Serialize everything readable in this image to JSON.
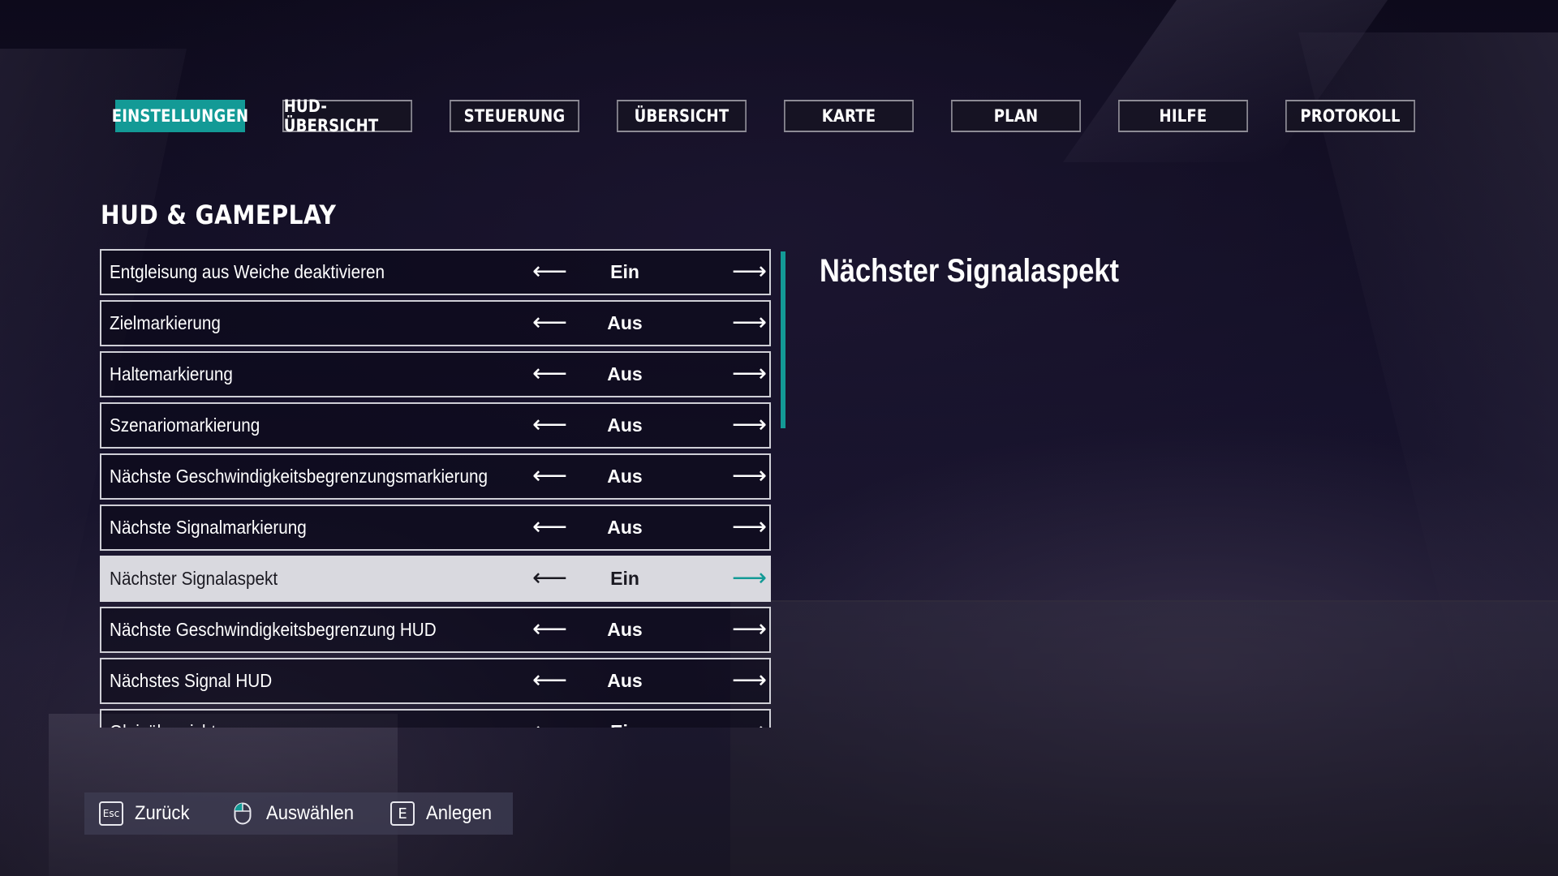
{
  "tabs": [
    {
      "label": "EINSTELLUNGEN",
      "active": true
    },
    {
      "label": "HUD-ÜBERSICHT",
      "active": false
    },
    {
      "label": "STEUERUNG",
      "active": false
    },
    {
      "label": "ÜBERSICHT",
      "active": false
    },
    {
      "label": "KARTE",
      "active": false
    },
    {
      "label": "PLAN",
      "active": false
    },
    {
      "label": "HILFE",
      "active": false
    },
    {
      "label": "PROTOKOLL",
      "active": false
    }
  ],
  "section": {
    "title": "HUD & GAMEPLAY"
  },
  "options": [
    {
      "label": "Entgleisung aus Weiche deaktivieren",
      "value": "Ein"
    },
    {
      "label": "Zielmarkierung",
      "value": "Aus"
    },
    {
      "label": "Haltemarkierung",
      "value": "Aus"
    },
    {
      "label": "Szenariomarkierung",
      "value": "Aus"
    },
    {
      "label": "Nächste Geschwindigkeitsbegrenzungsmarkierung",
      "value": "Aus"
    },
    {
      "label": "Nächste Signalmarkierung",
      "value": "Aus"
    },
    {
      "label": "Nächster Signalaspekt",
      "value": "Ein",
      "selected": true
    },
    {
      "label": "Nächste Geschwindigkeitsbegrenzung HUD",
      "value": "Aus"
    },
    {
      "label": "Nächstes Signal HUD",
      "value": "Aus"
    },
    {
      "label": "Gleisübersicht",
      "value": "Ein"
    }
  ],
  "arrows": {
    "left": "⟵",
    "right": "⟶"
  },
  "description": {
    "title": "Nächster Signalaspekt"
  },
  "footer": {
    "back": {
      "key": "Esc",
      "label": "Zurück"
    },
    "select": {
      "icon": "mouse-left-click-icon",
      "label": "Auswählen"
    },
    "apply": {
      "key": "E",
      "label": "Anlegen"
    }
  },
  "colors": {
    "accent": "#139a96",
    "selected_row": "#d9d9df",
    "footer_bg": "#3e3c52"
  }
}
